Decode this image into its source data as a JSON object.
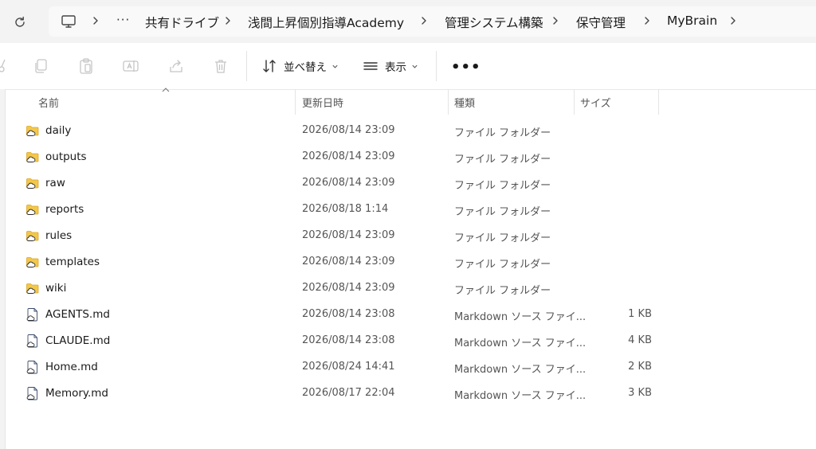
{
  "breadcrumbs": [
    "共有ドライブ",
    "浅間上昇個別指導Academy",
    "管理システム構築",
    "保守管理",
    "MyBrain"
  ],
  "address": {
    "overflow_label": "···"
  },
  "toolbar": {
    "sort_label": "並べ替え",
    "view_label": "表示",
    "more_label": "•••"
  },
  "columns": {
    "name": "名前",
    "modified": "更新日時",
    "type": "種類",
    "size": "サイズ"
  },
  "files": [
    {
      "name": "daily",
      "modified": "2026/08/14 23:09",
      "type": "ファイル フォルダー",
      "size": "",
      "icon": "folder-icon"
    },
    {
      "name": "outputs",
      "modified": "2026/08/14 23:09",
      "type": "ファイル フォルダー",
      "size": "",
      "icon": "folder-icon"
    },
    {
      "name": "raw",
      "modified": "2026/08/14 23:09",
      "type": "ファイル フォルダー",
      "size": "",
      "icon": "folder-icon"
    },
    {
      "name": "reports",
      "modified": "2026/08/18 1:14",
      "type": "ファイル フォルダー",
      "size": "",
      "icon": "folder-icon"
    },
    {
      "name": "rules",
      "modified": "2026/08/14 23:09",
      "type": "ファイル フォルダー",
      "size": "",
      "icon": "folder-icon"
    },
    {
      "name": "templates",
      "modified": "2026/08/14 23:09",
      "type": "ファイル フォルダー",
      "size": "",
      "icon": "folder-icon"
    },
    {
      "name": "wiki",
      "modified": "2026/08/14 23:09",
      "type": "ファイル フォルダー",
      "size": "",
      "icon": "folder-icon"
    },
    {
      "name": "AGENTS.md",
      "modified": "2026/08/14 23:08",
      "type": "Markdown ソース ファイ...",
      "size": "1 KB",
      "icon": "markdown-file-icon"
    },
    {
      "name": "CLAUDE.md",
      "modified": "2026/08/14 23:08",
      "type": "Markdown ソース ファイ...",
      "size": "4 KB",
      "icon": "markdown-file-icon"
    },
    {
      "name": "Home.md",
      "modified": "2026/08/24 14:41",
      "type": "Markdown ソース ファイ...",
      "size": "2 KB",
      "icon": "markdown-file-icon"
    },
    {
      "name": "Memory.md",
      "modified": "2026/08/17 22:04",
      "type": "Markdown ソース ファイ...",
      "size": "3 KB",
      "icon": "markdown-file-icon"
    }
  ],
  "colors": {
    "folder": "#f3c74a",
    "folder_dark": "#e0a92a",
    "cloud_outline": "#2b2b2b",
    "file_outline": "#3a4a6b"
  }
}
